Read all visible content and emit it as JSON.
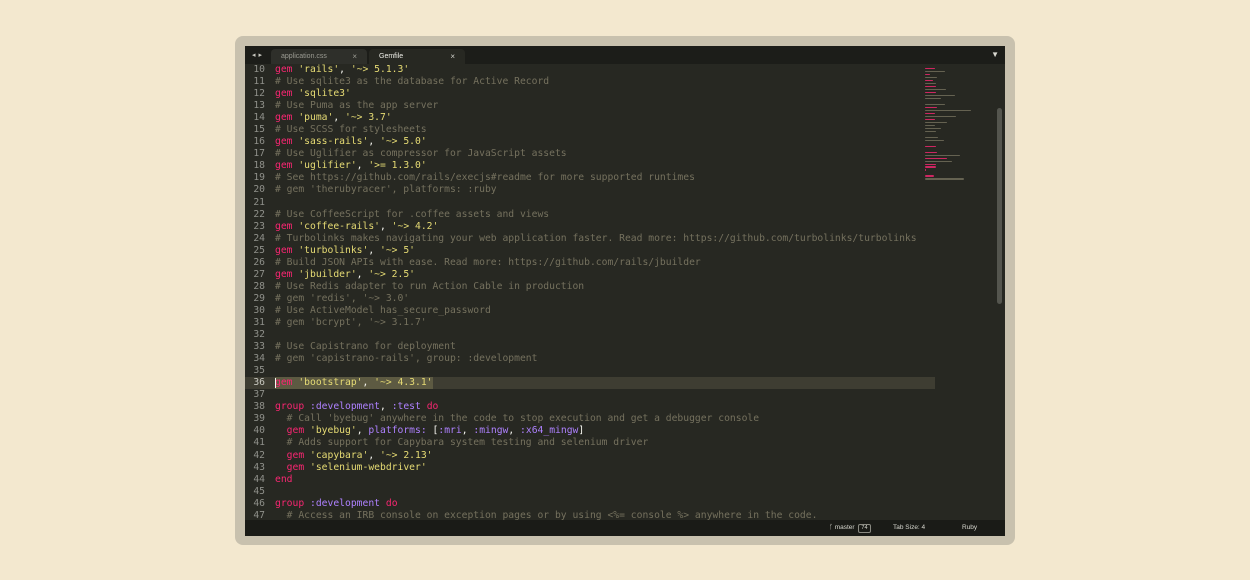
{
  "editor": {
    "tabs": [
      {
        "label": "application.css",
        "active": false
      },
      {
        "label": "Gemfile",
        "active": true
      }
    ],
    "close_glyph": "×",
    "nav_back_icon": "◂",
    "nav_forward_icon": "▸",
    "tab_menu_icon": "▼"
  },
  "code": {
    "highlighted_line": 36,
    "lines": [
      {
        "n": "10",
        "tokens": [
          {
            "t": "gem",
            "c": "kw"
          },
          {
            "t": " "
          },
          {
            "t": "'rails'",
            "c": "str"
          },
          {
            "t": ", "
          },
          {
            "t": "'~> 5.1.3'",
            "c": "str"
          }
        ]
      },
      {
        "n": "11",
        "tokens": [
          {
            "t": "# Use sqlite3 as the database for Active Record",
            "c": "cm"
          }
        ]
      },
      {
        "n": "12",
        "tokens": [
          {
            "t": "gem",
            "c": "kw"
          },
          {
            "t": " "
          },
          {
            "t": "'sqlite3'",
            "c": "str"
          }
        ]
      },
      {
        "n": "13",
        "tokens": [
          {
            "t": "# Use Puma as the app server",
            "c": "cm"
          }
        ]
      },
      {
        "n": "14",
        "tokens": [
          {
            "t": "gem",
            "c": "kw"
          },
          {
            "t": " "
          },
          {
            "t": "'puma'",
            "c": "str"
          },
          {
            "t": ", "
          },
          {
            "t": "'~> 3.7'",
            "c": "str"
          }
        ]
      },
      {
        "n": "15",
        "tokens": [
          {
            "t": "# Use SCSS for stylesheets",
            "c": "cm"
          }
        ]
      },
      {
        "n": "16",
        "tokens": [
          {
            "t": "gem",
            "c": "kw"
          },
          {
            "t": " "
          },
          {
            "t": "'sass-rails'",
            "c": "str"
          },
          {
            "t": ", "
          },
          {
            "t": "'~> 5.0'",
            "c": "str"
          }
        ]
      },
      {
        "n": "17",
        "tokens": [
          {
            "t": "# Use Uglifier as compressor for JavaScript assets",
            "c": "cm"
          }
        ]
      },
      {
        "n": "18",
        "tokens": [
          {
            "t": "gem",
            "c": "kw"
          },
          {
            "t": " "
          },
          {
            "t": "'uglifier'",
            "c": "str"
          },
          {
            "t": ", "
          },
          {
            "t": "'>= 1.3.0'",
            "c": "str"
          }
        ]
      },
      {
        "n": "19",
        "tokens": [
          {
            "t": "# See https://github.com/rails/execjs#readme for more supported runtimes",
            "c": "cm"
          }
        ]
      },
      {
        "n": "20",
        "tokens": [
          {
            "t": "# gem 'therubyracer', platforms: :ruby",
            "c": "cm"
          }
        ]
      },
      {
        "n": "21",
        "tokens": []
      },
      {
        "n": "22",
        "tokens": [
          {
            "t": "# Use CoffeeScript for .coffee assets and views",
            "c": "cm"
          }
        ]
      },
      {
        "n": "23",
        "tokens": [
          {
            "t": "gem",
            "c": "kw"
          },
          {
            "t": " "
          },
          {
            "t": "'coffee-rails'",
            "c": "str"
          },
          {
            "t": ", "
          },
          {
            "t": "'~> 4.2'",
            "c": "str"
          }
        ]
      },
      {
        "n": "24",
        "tokens": [
          {
            "t": "# Turbolinks makes navigating your web application faster. Read more: https://github.com/turbolinks/turbolinks",
            "c": "cm"
          }
        ]
      },
      {
        "n": "25",
        "tokens": [
          {
            "t": "gem",
            "c": "kw"
          },
          {
            "t": " "
          },
          {
            "t": "'turbolinks'",
            "c": "str"
          },
          {
            "t": ", "
          },
          {
            "t": "'~> 5'",
            "c": "str"
          }
        ]
      },
      {
        "n": "26",
        "tokens": [
          {
            "t": "# Build JSON APIs with ease. Read more: https://github.com/rails/jbuilder",
            "c": "cm"
          }
        ]
      },
      {
        "n": "27",
        "tokens": [
          {
            "t": "gem",
            "c": "kw"
          },
          {
            "t": " "
          },
          {
            "t": "'jbuilder'",
            "c": "str"
          },
          {
            "t": ", "
          },
          {
            "t": "'~> 2.5'",
            "c": "str"
          }
        ]
      },
      {
        "n": "28",
        "tokens": [
          {
            "t": "# Use Redis adapter to run Action Cable in production",
            "c": "cm"
          }
        ]
      },
      {
        "n": "29",
        "tokens": [
          {
            "t": "# gem 'redis', '~> 3.0'",
            "c": "cm"
          }
        ]
      },
      {
        "n": "30",
        "tokens": [
          {
            "t": "# Use ActiveModel has_secure_password",
            "c": "cm"
          }
        ]
      },
      {
        "n": "31",
        "tokens": [
          {
            "t": "# gem 'bcrypt', '~> 3.1.7'",
            "c": "cm"
          }
        ]
      },
      {
        "n": "32",
        "tokens": []
      },
      {
        "n": "33",
        "tokens": [
          {
            "t": "# Use Capistrano for deployment",
            "c": "cm"
          }
        ]
      },
      {
        "n": "34",
        "tokens": [
          {
            "t": "# gem 'capistrano-rails', group: :development",
            "c": "cm"
          }
        ]
      },
      {
        "n": "35",
        "tokens": []
      },
      {
        "n": "36",
        "tokens": [
          {
            "t": "gem",
            "c": "kw"
          },
          {
            "t": " "
          },
          {
            "t": "'bootstrap'",
            "c": "str"
          },
          {
            "t": ", "
          },
          {
            "t": "'~> 4.3.1'",
            "c": "str"
          }
        ]
      },
      {
        "n": "37",
        "tokens": []
      },
      {
        "n": "38",
        "tokens": [
          {
            "t": "group",
            "c": "kw"
          },
          {
            "t": " "
          },
          {
            "t": ":development",
            "c": "sym"
          },
          {
            "t": ", "
          },
          {
            "t": ":test",
            "c": "sym"
          },
          {
            "t": " "
          },
          {
            "t": "do",
            "c": "kw"
          }
        ]
      },
      {
        "n": "39",
        "tokens": [
          {
            "t": "  # Call 'byebug' anywhere in the code to stop execution and get a debugger console",
            "c": "cm"
          }
        ]
      },
      {
        "n": "40",
        "tokens": [
          {
            "t": "  "
          },
          {
            "t": "gem",
            "c": "kw"
          },
          {
            "t": " "
          },
          {
            "t": "'byebug'",
            "c": "str"
          },
          {
            "t": ", "
          },
          {
            "t": "platforms:",
            "c": "sym"
          },
          {
            "t": " ["
          },
          {
            "t": ":mri",
            "c": "sym"
          },
          {
            "t": ", "
          },
          {
            "t": ":mingw",
            "c": "sym"
          },
          {
            "t": ", "
          },
          {
            "t": ":x64_mingw",
            "c": "sym"
          },
          {
            "t": "]"
          }
        ]
      },
      {
        "n": "41",
        "tokens": [
          {
            "t": "  # Adds support for Capybara system testing and selenium driver",
            "c": "cm"
          }
        ]
      },
      {
        "n": "42",
        "tokens": [
          {
            "t": "  "
          },
          {
            "t": "gem",
            "c": "kw"
          },
          {
            "t": " "
          },
          {
            "t": "'capybara'",
            "c": "str"
          },
          {
            "t": ", "
          },
          {
            "t": "'~> 2.13'",
            "c": "str"
          }
        ]
      },
      {
        "n": "43",
        "tokens": [
          {
            "t": "  "
          },
          {
            "t": "gem",
            "c": "kw"
          },
          {
            "t": " "
          },
          {
            "t": "'selenium-webdriver'",
            "c": "str"
          }
        ]
      },
      {
        "n": "44",
        "tokens": [
          {
            "t": "end",
            "c": "kw"
          }
        ]
      },
      {
        "n": "45",
        "tokens": []
      },
      {
        "n": "46",
        "tokens": [
          {
            "t": "group",
            "c": "kw"
          },
          {
            "t": " "
          },
          {
            "t": ":development",
            "c": "sym"
          },
          {
            "t": " "
          },
          {
            "t": "do",
            "c": "kw"
          }
        ]
      },
      {
        "n": "47",
        "tokens": [
          {
            "t": "  # Access an IRB console on exception pages or by using <%= console %> anywhere in the code.",
            "c": "cm"
          }
        ]
      }
    ]
  },
  "colors": {
    "keyword": "#f92672",
    "string": "#e6db74",
    "symbol": "#ae81ff",
    "comment": "#75715e",
    "text": "#f8f8f2",
    "background": "#272822"
  },
  "statusbar": {
    "branch_icon": "git-branch-icon",
    "branch": "master",
    "branch_count": "74",
    "tab_size": "Tab Size: 4",
    "syntax": "Ruby"
  }
}
